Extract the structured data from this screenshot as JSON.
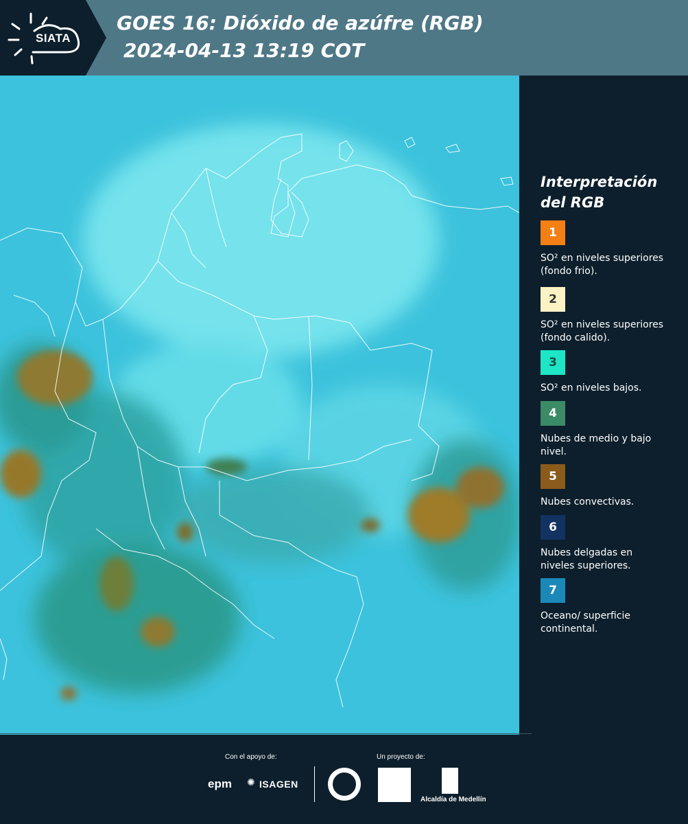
{
  "header": {
    "logo_text": "SIATA",
    "title": "GOES 16: Dióxido de azúfre (RGB)",
    "datetime": "2024-04-13 13:19 COT"
  },
  "legend": {
    "title_line1": "Interpretación",
    "title_line2": "del RGB",
    "items": [
      {
        "number": "1",
        "color": "#f47f14",
        "text_color": "#ffffff",
        "label": "SO² en niveles superiores (fondo frio)."
      },
      {
        "number": "2",
        "color": "#fbf3c4",
        "text_color": "#333333",
        "label": "SO² en niveles superiores (fondo calido)."
      },
      {
        "number": "3",
        "color": "#1de5c6",
        "text_color": "#1a4a44",
        "label": "SO² en niveles bajos."
      },
      {
        "number": "4",
        "color": "#3b8b67",
        "text_color": "#ffffff",
        "label": "Nubes de medio y bajo nivel."
      },
      {
        "number": "5",
        "color": "#8a5b1a",
        "text_color": "#ffffff",
        "label": "Nubes convectivas."
      },
      {
        "number": "6",
        "color": "#123262",
        "text_color": "#ffffff",
        "label": "Nubes delgadas en niveles superiores."
      },
      {
        "number": "7",
        "color": "#1b89b8",
        "text_color": "#ffffff",
        "label": "Oceano/ superficie continental."
      }
    ]
  },
  "footer": {
    "support_label": "Con el apoyo de:",
    "project_label": "Un proyecto de:",
    "sponsor1": "epm",
    "sponsor2": "ISAGEN",
    "partner_alcaldia": "Alcaldía de Medellín"
  }
}
